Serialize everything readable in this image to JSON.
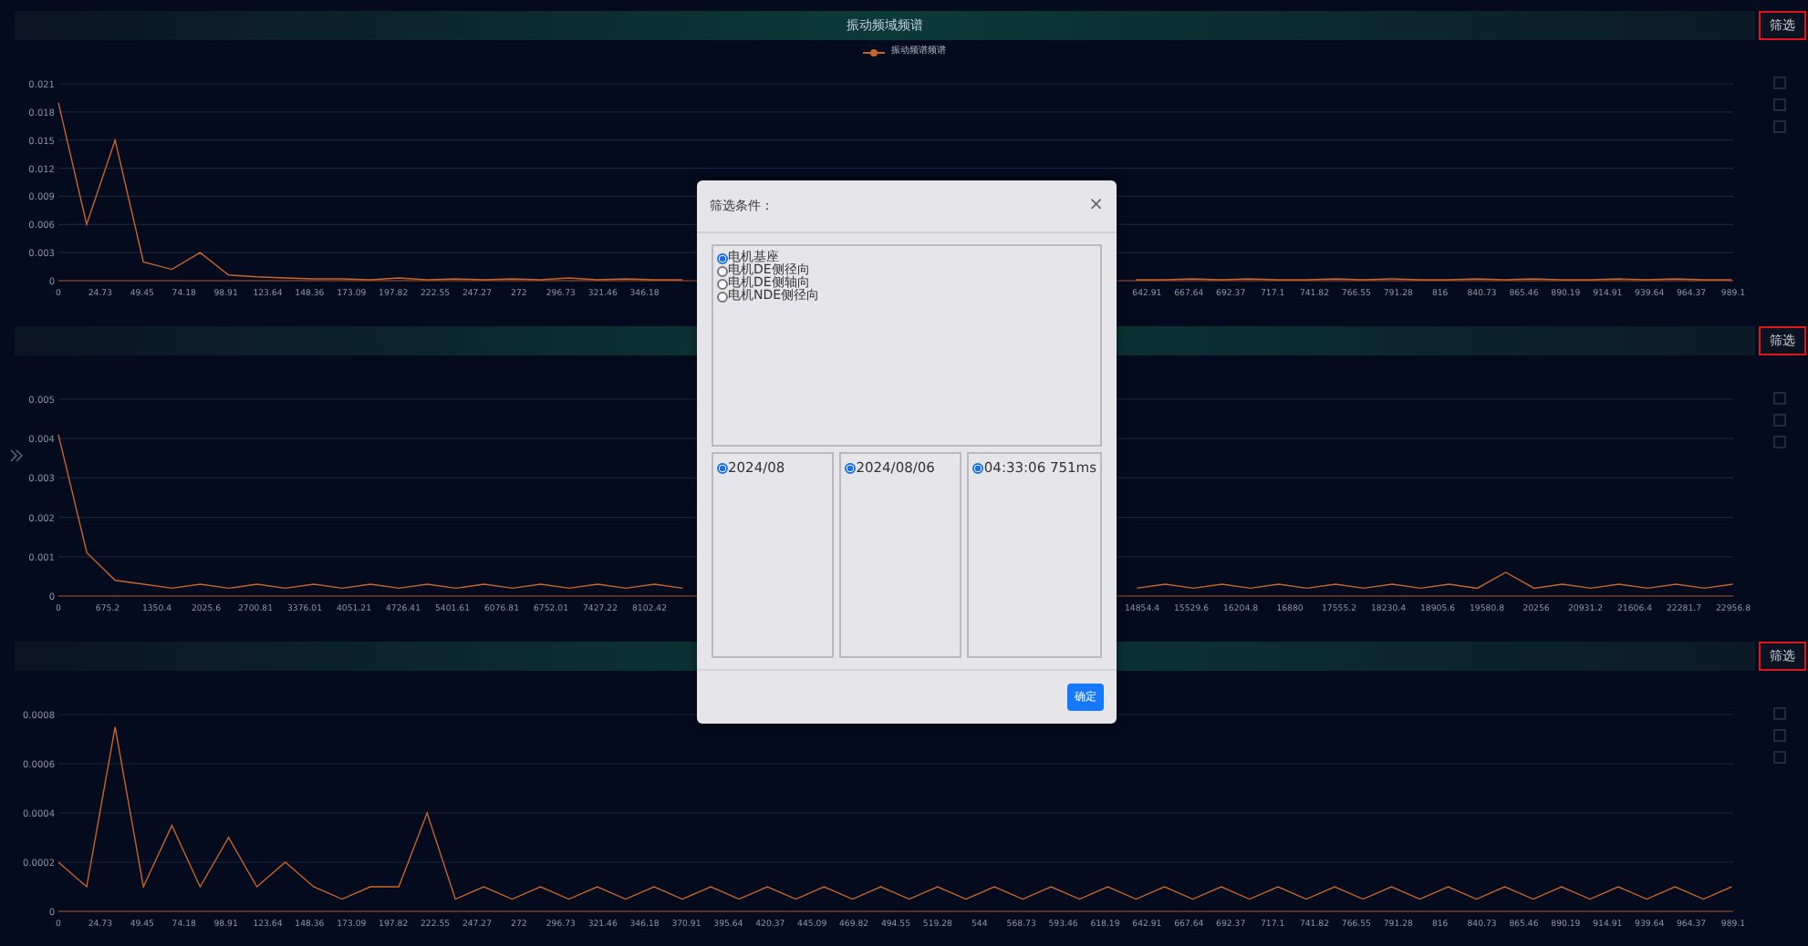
{
  "panels": [
    {
      "title": "振动频域频谱",
      "filter_button": "筛选",
      "chart_data": {
        "type": "line",
        "grid": true,
        "xlim": [
          0,
          989.1
        ],
        "ylim": [
          0,
          0.021
        ],
        "yticks": [
          {
            "value": 0,
            "label": "0"
          },
          {
            "value": 0.003,
            "label": "0.003"
          },
          {
            "value": 0.006,
            "label": "0.006"
          },
          {
            "value": 0.009,
            "label": "0.009"
          },
          {
            "value": 0.012,
            "label": "0.012"
          },
          {
            "value": 0.015,
            "label": "0.015"
          },
          {
            "value": 0.018,
            "label": "0.018"
          },
          {
            "value": 0.021,
            "label": "0.021"
          }
        ],
        "xticks": [
          {
            "value": 0,
            "label": "0"
          },
          {
            "value": 24.73,
            "label": "24.73"
          },
          {
            "value": 49.45,
            "label": "49.45"
          },
          {
            "value": 74.18,
            "label": "74.18"
          },
          {
            "value": 98.91,
            "label": "98.91"
          },
          {
            "value": 123.64,
            "label": "123.64"
          },
          {
            "value": 148.36,
            "label": "148.36"
          },
          {
            "value": 173.09,
            "label": "173.09"
          },
          {
            "value": 197.82,
            "label": "197.82"
          },
          {
            "value": 222.55,
            "label": "222.55"
          },
          {
            "value": 247.27,
            "label": "247.27"
          },
          {
            "value": 272,
            "label": "272"
          },
          {
            "value": 296.73,
            "label": "296.73"
          },
          {
            "value": 321.46,
            "label": "321.46"
          },
          {
            "value": 346.18,
            "label": "346.18"
          },
          {
            "value": 642.91,
            "label": "642.91"
          },
          {
            "value": 667.64,
            "label": "667.64"
          },
          {
            "value": 692.37,
            "label": "692.37"
          },
          {
            "value": 717.1,
            "label": "717.1"
          },
          {
            "value": 741.82,
            "label": "741.82"
          },
          {
            "value": 766.55,
            "label": "766.55"
          },
          {
            "value": 791.28,
            "label": "791.28"
          },
          {
            "value": 816,
            "label": "816"
          },
          {
            "value": 840.73,
            "label": "840.73"
          },
          {
            "value": 865.46,
            "label": "865.46"
          },
          {
            "value": 890.19,
            "label": "890.19"
          },
          {
            "value": 914.91,
            "label": "914.91"
          },
          {
            "value": 939.64,
            "label": "939.64"
          },
          {
            "value": 964.37,
            "label": "964.37"
          },
          {
            "value": 989.1,
            "label": "989.1"
          }
        ],
        "x": [
          0,
          16.75,
          33.5,
          50.25,
          67,
          83.75,
          100.5,
          117.25,
          134,
          150.75,
          167.5,
          184.25,
          201,
          217.75,
          234.5,
          251.25,
          268,
          284.75,
          301.5,
          318.25,
          335,
          351.75,
          368.5,
          636.5,
          653.25,
          670,
          686.75,
          703.5,
          720.25,
          737,
          753.75,
          770.5,
          787.25,
          804,
          820.75,
          837.5,
          854.25,
          871,
          887.75,
          904.5,
          921.25,
          938,
          954.75,
          971.5,
          988.25
        ],
        "series": [
          {
            "name": "振动频谱频谱",
            "color": "#c8642c",
            "values": [
              0.019,
              0.006,
              0.015,
              0.002,
              0.0012,
              0.003,
              0.0006,
              0.0004,
              0.0003,
              0.0002,
              0.0002,
              0.0001,
              0.0003,
              0.0001,
              0.0002,
              0.0001,
              0.0002,
              0.0001,
              0.0003,
              0.0001,
              0.0002,
              0.0001,
              0.0001,
              0.0001,
              0.0001,
              0.0002,
              0.0001,
              0.0002,
              0.0001,
              0.0001,
              0.0002,
              0.0001,
              0.0002,
              0.0001,
              0.0001,
              0.0002,
              0.0001,
              0.0002,
              0.0001,
              0.0001,
              0.0002,
              0.0001,
              0.0002,
              0.0001,
              0.0001
            ]
          }
        ]
      }
    },
    {
      "filter_button": "筛选",
      "chart_data": {
        "type": "line",
        "grid": true,
        "xlim": [
          0,
          22956.8
        ],
        "ylim": [
          0,
          0.005
        ],
        "yticks": [
          {
            "value": 0,
            "label": "0"
          },
          {
            "value": 0.001,
            "label": "0.001"
          },
          {
            "value": 0.002,
            "label": "0.002"
          },
          {
            "value": 0.003,
            "label": "0.003"
          },
          {
            "value": 0.004,
            "label": "0.004"
          },
          {
            "value": 0.005,
            "label": "0.005"
          }
        ],
        "xticks": [
          {
            "value": 0,
            "label": "0"
          },
          {
            "value": 675.2,
            "label": "675.2"
          },
          {
            "value": 1350.4,
            "label": "1350.4"
          },
          {
            "value": 2025.6,
            "label": "2025.6"
          },
          {
            "value": 2700.81,
            "label": "2700.81"
          },
          {
            "value": 3376.01,
            "label": "3376.01"
          },
          {
            "value": 4051.21,
            "label": "4051.21"
          },
          {
            "value": 4726.41,
            "label": "4726.41"
          },
          {
            "value": 5401.61,
            "label": "5401.61"
          },
          {
            "value": 6076.81,
            "label": "6076.81"
          },
          {
            "value": 6752.01,
            "label": "6752.01"
          },
          {
            "value": 7427.22,
            "label": "7427.22"
          },
          {
            "value": 8102.42,
            "label": "8102.42"
          },
          {
            "value": 14854.4,
            "label": "14854.4"
          },
          {
            "value": 15529.6,
            "label": "15529.6"
          },
          {
            "value": 16204.8,
            "label": "16204.8"
          },
          {
            "value": 16880,
            "label": "16880"
          },
          {
            "value": 17555.2,
            "label": "17555.2"
          },
          {
            "value": 18230.4,
            "label": "18230.4"
          },
          {
            "value": 18905.6,
            "label": "18905.6"
          },
          {
            "value": 19580.8,
            "label": "19580.8"
          },
          {
            "value": 20256,
            "label": "20256"
          },
          {
            "value": 20931.2,
            "label": "20931.2"
          },
          {
            "value": 21606.4,
            "label": "21606.4"
          },
          {
            "value": 22281.7,
            "label": "22281.7"
          },
          {
            "value": 22956.8,
            "label": "22956.8"
          }
        ],
        "x": [
          0,
          389,
          778,
          1167,
          1556,
          1945,
          2334,
          2723,
          3112,
          3501,
          3890,
          4279,
          4668,
          5057,
          5446,
          5835,
          6224,
          6613,
          7002,
          7391,
          7780,
          8169,
          8558,
          14782,
          15171,
          15560,
          15949,
          16338,
          16727,
          17116,
          17505,
          17894,
          18283,
          18672,
          19061,
          19450,
          19839,
          20228,
          20617,
          21006,
          21395,
          21784,
          22173,
          22562,
          22951
        ],
        "series": [
          {
            "color": "#c8642c",
            "values": [
              0.0041,
              0.0011,
              0.0004,
              0.0003,
              0.0002,
              0.0003,
              0.0002,
              0.0003,
              0.0002,
              0.0003,
              0.0002,
              0.0003,
              0.0002,
              0.0003,
              0.0002,
              0.0003,
              0.0002,
              0.0003,
              0.0002,
              0.0003,
              0.0002,
              0.0003,
              0.0002,
              0.0002,
              0.0003,
              0.0002,
              0.0003,
              0.0002,
              0.0003,
              0.0002,
              0.0003,
              0.0002,
              0.0003,
              0.0002,
              0.0003,
              0.0002,
              0.0006,
              0.0002,
              0.0003,
              0.0002,
              0.0003,
              0.0002,
              0.0003,
              0.0002,
              0.0003
            ]
          }
        ]
      }
    },
    {
      "filter_button": "筛选",
      "chart_data": {
        "type": "line",
        "grid": true,
        "xlim": [
          0,
          989.1
        ],
        "ylim": [
          0,
          0.0008
        ],
        "yticks": [
          {
            "value": 0,
            "label": "0"
          },
          {
            "value": 0.0002,
            "label": "0.0002"
          },
          {
            "value": 0.0004,
            "label": "0.0004"
          },
          {
            "value": 0.0006,
            "label": "0.0006"
          },
          {
            "value": 0.0008,
            "label": "0.0008"
          }
        ],
        "xticks": [
          {
            "value": 0,
            "label": "0"
          },
          {
            "value": 24.73,
            "label": "24.73"
          },
          {
            "value": 49.45,
            "label": "49.45"
          },
          {
            "value": 74.18,
            "label": "74.18"
          },
          {
            "value": 98.91,
            "label": "98.91"
          },
          {
            "value": 123.64,
            "label": "123.64"
          },
          {
            "value": 148.36,
            "label": "148.36"
          },
          {
            "value": 173.09,
            "label": "173.09"
          },
          {
            "value": 197.82,
            "label": "197.82"
          },
          {
            "value": 222.55,
            "label": "222.55"
          },
          {
            "value": 247.27,
            "label": "247.27"
          },
          {
            "value": 272,
            "label": "272"
          },
          {
            "value": 296.73,
            "label": "296.73"
          },
          {
            "value": 321.46,
            "label": "321.46"
          },
          {
            "value": 346.18,
            "label": "346.18"
          },
          {
            "value": 370.91,
            "label": "370.91"
          },
          {
            "value": 395.64,
            "label": "395.64"
          },
          {
            "value": 420.37,
            "label": "420.37"
          },
          {
            "value": 445.09,
            "label": "445.09"
          },
          {
            "value": 469.82,
            "label": "469.82"
          },
          {
            "value": 494.55,
            "label": "494.55"
          },
          {
            "value": 519.28,
            "label": "519.28"
          },
          {
            "value": 544,
            "label": "544"
          },
          {
            "value": 568.73,
            "label": "568.73"
          },
          {
            "value": 593.46,
            "label": "593.46"
          },
          {
            "value": 618.19,
            "label": "618.19"
          },
          {
            "value": 642.91,
            "label": "642.91"
          },
          {
            "value": 667.64,
            "label": "667.64"
          },
          {
            "value": 692.37,
            "label": "692.37"
          },
          {
            "value": 717.1,
            "label": "717.1"
          },
          {
            "value": 741.82,
            "label": "741.82"
          },
          {
            "value": 766.55,
            "label": "766.55"
          },
          {
            "value": 791.28,
            "label": "791.28"
          },
          {
            "value": 816,
            "label": "816"
          },
          {
            "value": 840.73,
            "label": "840.73"
          },
          {
            "value": 865.46,
            "label": "865.46"
          },
          {
            "value": 890.19,
            "label": "890.19"
          },
          {
            "value": 914.91,
            "label": "914.91"
          },
          {
            "value": 939.64,
            "label": "939.64"
          },
          {
            "value": 964.37,
            "label": "964.37"
          },
          {
            "value": 989.1,
            "label": "989.1"
          }
        ],
        "x": [
          0,
          16.75,
          33.5,
          50.25,
          67,
          83.75,
          100.5,
          117.25,
          134,
          150.75,
          167.5,
          184.25,
          201,
          217.75,
          234.5,
          251.25,
          268,
          284.75,
          301.5,
          318.25,
          335,
          351.75,
          368.5,
          385.25,
          402,
          418.75,
          435.5,
          452.25,
          469,
          485.75,
          502.5,
          519.25,
          536,
          552.75,
          569.5,
          586.25,
          603,
          619.75,
          636.5,
          653.25,
          670,
          686.75,
          703.5,
          720.25,
          737,
          753.75,
          770.5,
          787.25,
          804,
          820.75,
          837.5,
          854.25,
          871,
          887.75,
          904.5,
          921.25,
          938,
          954.75,
          971.5,
          988.25
        ],
        "series": [
          {
            "color": "#c8642c",
            "values": [
              0.0002,
              0.0001,
              0.00075,
              0.0001,
              0.00035,
              0.0001,
              0.0003,
              0.0001,
              0.0002,
              0.0001,
              5e-05,
              0.0001,
              0.0001,
              0.0004,
              5e-05,
              0.0001,
              5e-05,
              0.0001,
              5e-05,
              0.0001,
              5e-05,
              0.0001,
              5e-05,
              0.0001,
              5e-05,
              0.0001,
              5e-05,
              0.0001,
              5e-05,
              0.0001,
              5e-05,
              0.0001,
              5e-05,
              0.0001,
              5e-05,
              0.0001,
              5e-05,
              0.0001,
              5e-05,
              0.0001,
              5e-05,
              0.0001,
              5e-05,
              0.0001,
              5e-05,
              0.0001,
              5e-05,
              0.0001,
              5e-05,
              0.0001,
              5e-05,
              0.0001,
              5e-05,
              0.0001,
              5e-05,
              0.0001,
              5e-05,
              0.0001,
              5e-05,
              0.0001
            ]
          }
        ]
      }
    }
  ],
  "dialog": {
    "title": "筛选条件：",
    "close": "×",
    "positions": [
      {
        "label": "电机基座",
        "selected": true
      },
      {
        "label": "电机DE侧径向",
        "selected": false
      },
      {
        "label": "电机DE侧轴向",
        "selected": false
      },
      {
        "label": "电机NDE侧径向",
        "selected": false
      }
    ],
    "columns": [
      [
        {
          "label": "2024/08",
          "selected": true
        }
      ],
      [
        {
          "label": "2024/08/06",
          "selected": true
        }
      ],
      [
        {
          "label": "04:33:06 751ms",
          "selected": true
        }
      ]
    ],
    "confirm": "确定"
  }
}
